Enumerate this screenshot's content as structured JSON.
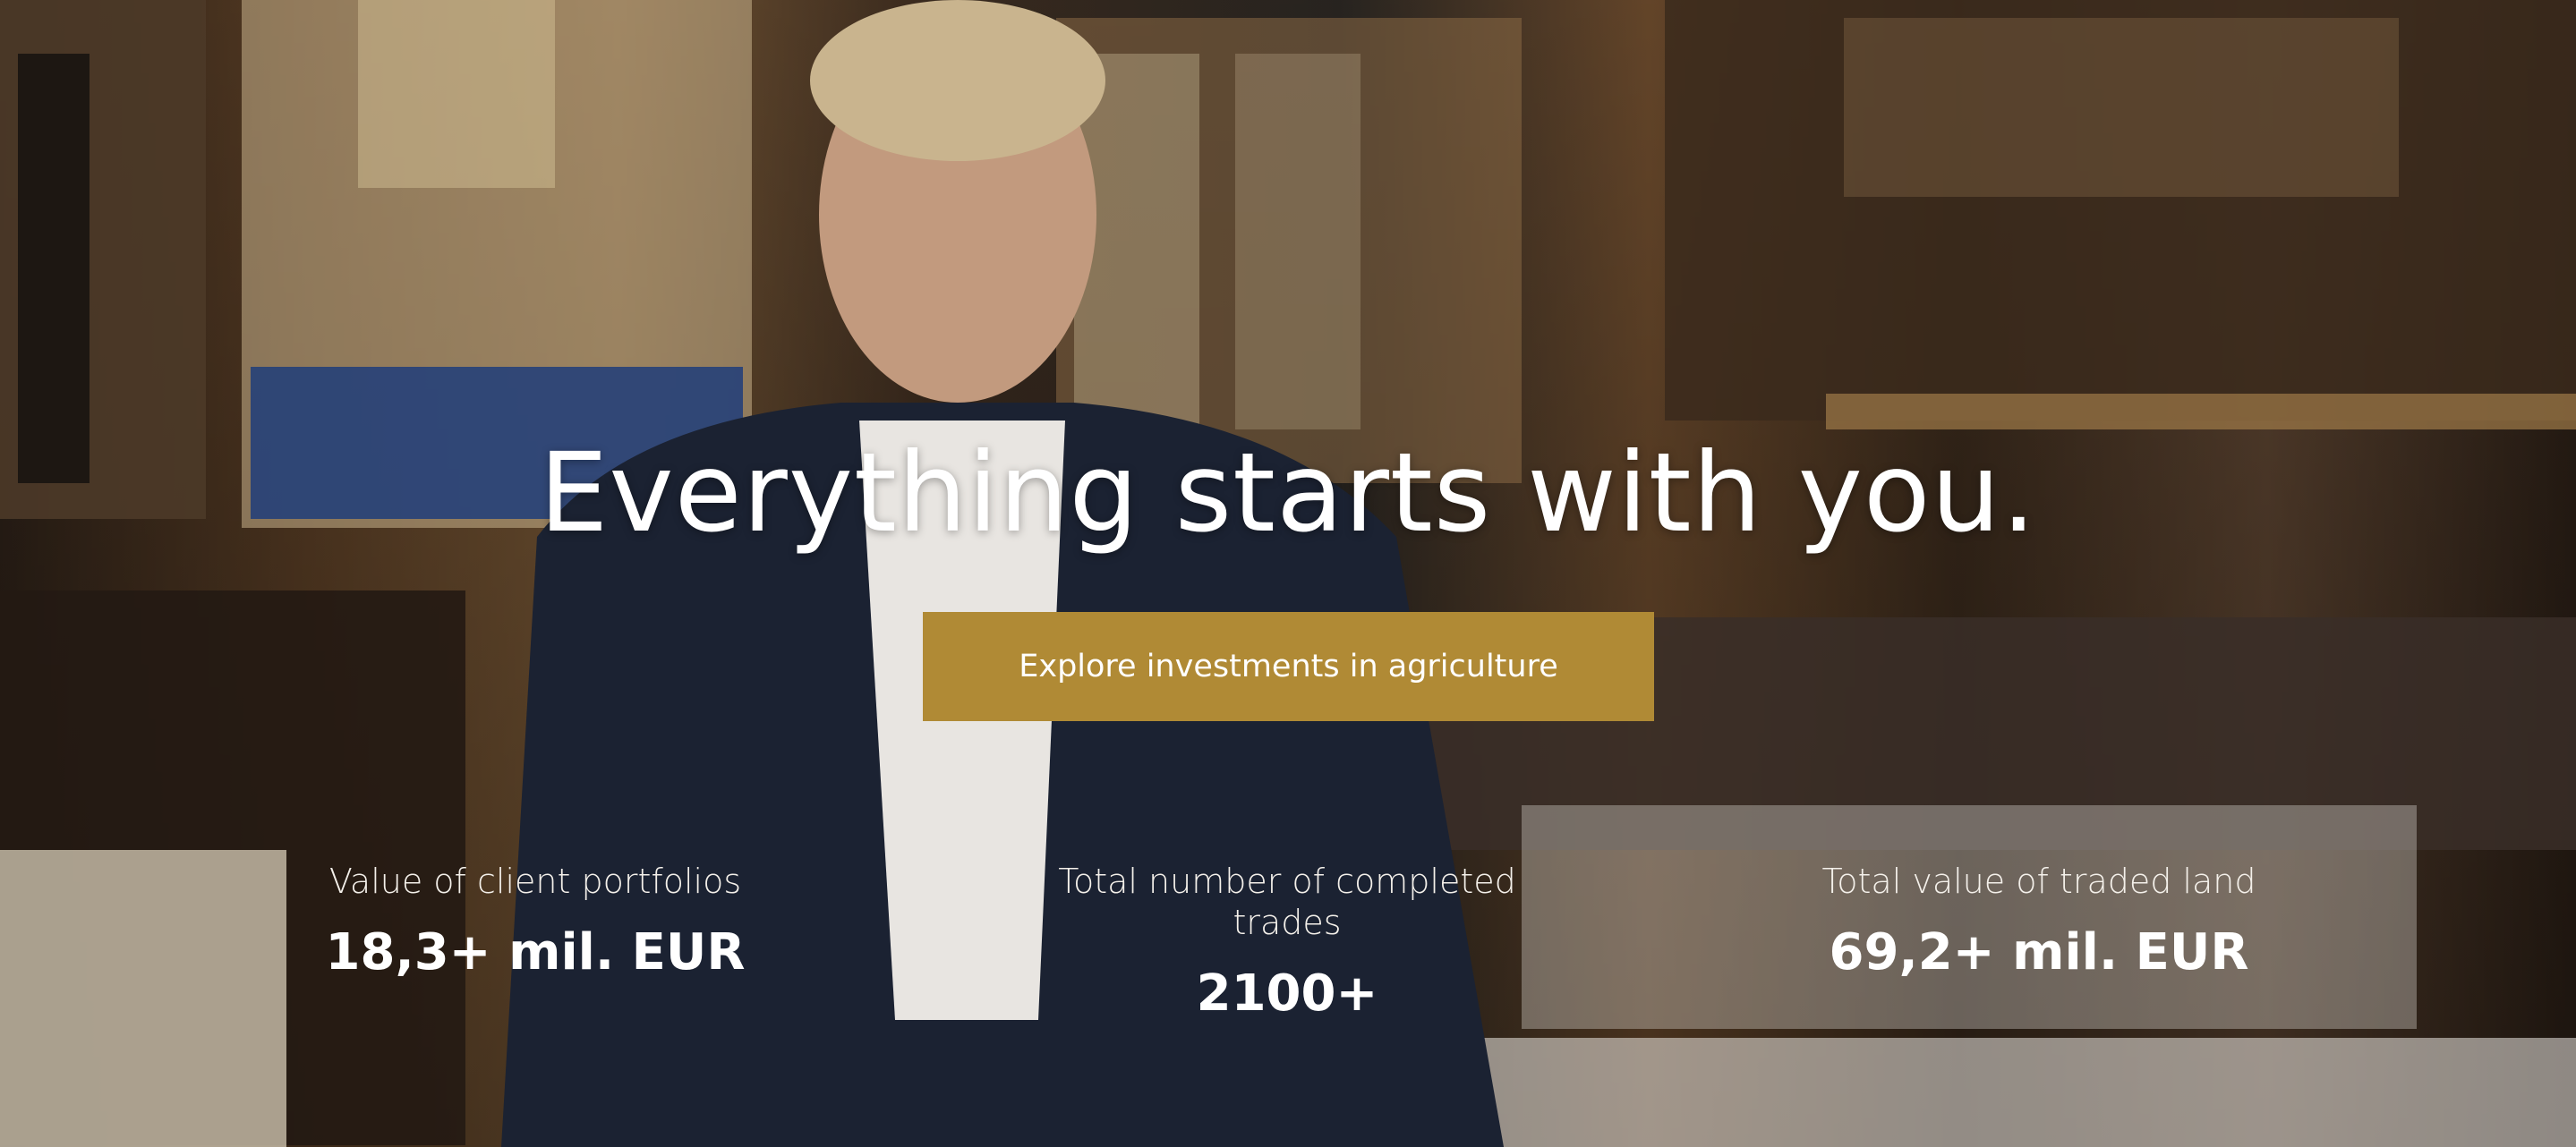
{
  "hero": {
    "headline": "Everything starts with you.",
    "cta_label": "Explore investments in agriculture",
    "accent_color": "#b08a35"
  },
  "stats": [
    {
      "label": "Value of client portfolios",
      "value": "18,3+ mil. EUR"
    },
    {
      "label": "Total number of completed trades",
      "value": "2100+"
    },
    {
      "label": "Total value of traded land",
      "value": "69,2+ mil. EUR"
    }
  ]
}
